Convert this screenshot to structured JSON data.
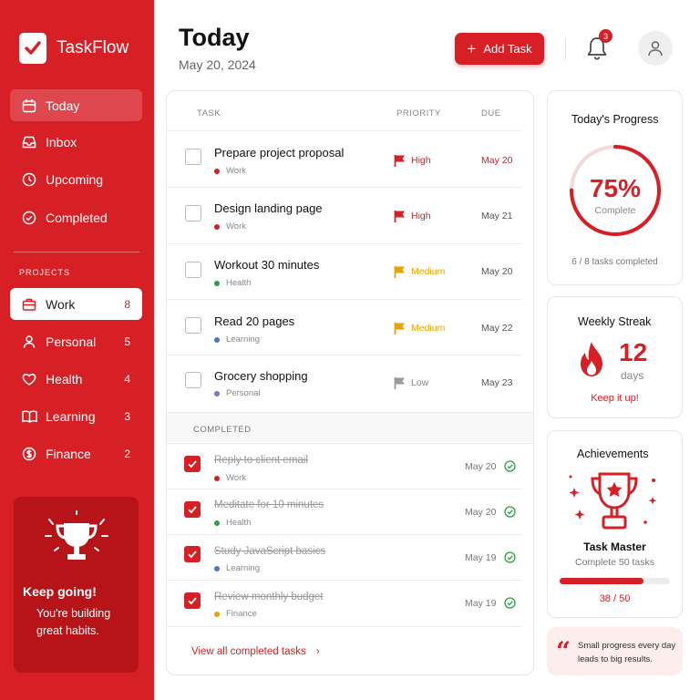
{
  "app": {
    "name": "TaskFlow"
  },
  "nav": [
    {
      "label": "Today",
      "icon": "calendar-icon"
    },
    {
      "label": "Inbox",
      "icon": "inbox-icon"
    },
    {
      "label": "Upcoming",
      "icon": "clock-icon"
    },
    {
      "label": "Completed",
      "icon": "check-circle-icon"
    }
  ],
  "projects": {
    "heading": "PROJECTS",
    "items": [
      {
        "label": "Work",
        "count": "8",
        "icon": "briefcase-icon"
      },
      {
        "label": "Personal",
        "count": "5",
        "icon": "user-icon"
      },
      {
        "label": "Health",
        "count": "4",
        "icon": "heart-icon"
      },
      {
        "label": "Learning",
        "count": "3",
        "icon": "book-icon"
      },
      {
        "label": "Finance",
        "count": "2",
        "icon": "dollar-icon"
      }
    ]
  },
  "motivation": {
    "title": "Keep going!",
    "text": "You're building great habits."
  },
  "header": {
    "title": "Today",
    "date": "May 20, 2024",
    "add_label": "Add Task",
    "notifications": "3"
  },
  "table": {
    "headers": {
      "task": "TASK",
      "priority": "PRIORITY",
      "due": "DUE"
    },
    "tasks": [
      {
        "title": "Prepare project proposal",
        "tag": "Work",
        "priority": "High",
        "due": "May 20"
      },
      {
        "title": "Design landing page",
        "tag": "Work",
        "priority": "High",
        "due": "May 21"
      },
      {
        "title": "Workout 30 minutes",
        "tag": "Health",
        "priority": "Medium",
        "due": "May 20"
      },
      {
        "title": "Read 20 pages",
        "tag": "Learning",
        "priority": "Medium",
        "due": "May 22"
      },
      {
        "title": "Grocery shopping",
        "tag": "Personal",
        "priority": "Low",
        "due": "May 23"
      }
    ],
    "completed_heading": "COMPLETED",
    "completed": [
      {
        "title": "Reply to client email",
        "tag": "Work",
        "due": "May 20"
      },
      {
        "title": "Meditate for 10 minutes",
        "tag": "Health",
        "due": "May 20"
      },
      {
        "title": "Study JavaScript basics",
        "tag": "Learning",
        "due": "May 19"
      },
      {
        "title": "Review monthly budget",
        "tag": "Finance",
        "due": "May 19"
      }
    ],
    "view_all": "View all completed tasks"
  },
  "progress": {
    "title": "Today's Progress",
    "percent": "75%",
    "label": "Complete",
    "fraction": 0.75,
    "foot": "6 / 8 tasks completed"
  },
  "streak": {
    "title": "Weekly Streak",
    "value": "12",
    "unit": "days",
    "foot": "Keep it up!"
  },
  "achievement": {
    "title": "Achievements",
    "name": "Task Master",
    "desc": "Complete 50 tasks",
    "count": "38 / 50",
    "fraction": 0.76
  },
  "quote": {
    "text": "Small progress every day leads to big results."
  },
  "colors": {
    "accent": "#d71f26",
    "medium": "#e8a300",
    "low": "#9a9a9a",
    "work": "#d71f26",
    "health": "#2e9e44",
    "learning": "#4a78c8",
    "personal": "#8e6cc7",
    "finance": "#e8a300",
    "ok": "#2e9e44"
  }
}
